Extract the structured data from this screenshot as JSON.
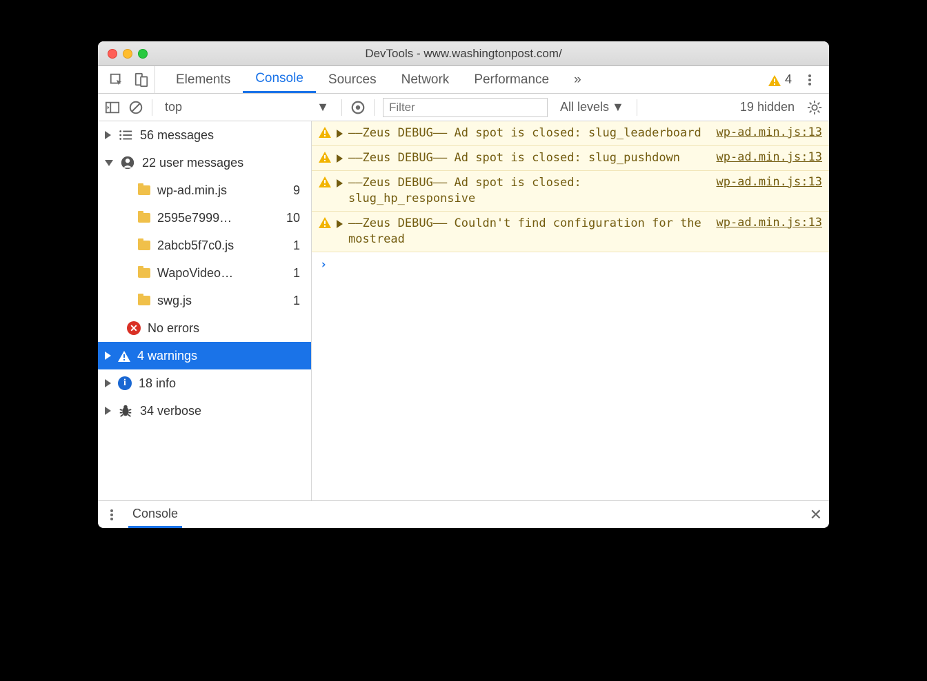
{
  "window": {
    "title": "DevTools - www.washingtonpost.com/"
  },
  "tabs": {
    "items": [
      "Elements",
      "Console",
      "Sources",
      "Network",
      "Performance"
    ],
    "activeIndex": 1,
    "moreSymbol": "»",
    "warningCount": "4"
  },
  "toolbar": {
    "context": "top",
    "filterPlaceholder": "Filter",
    "levelsLabel": "All levels",
    "hiddenLabel": "19 hidden"
  },
  "sidebar": {
    "messages": {
      "label": "56 messages"
    },
    "userMessages": {
      "label": "22 user messages"
    },
    "files": [
      {
        "name": "wp-ad.min.js",
        "count": "9"
      },
      {
        "name": "2595e7999…",
        "count": "10"
      },
      {
        "name": "2abcb5f7c0.js",
        "count": "1"
      },
      {
        "name": "WapoVideo…",
        "count": "1"
      },
      {
        "name": "swg.js",
        "count": "1"
      }
    ],
    "errors": {
      "label": "No errors"
    },
    "warnings": {
      "label": "4 warnings"
    },
    "info": {
      "label": "18 info"
    },
    "verbose": {
      "label": "34 verbose"
    }
  },
  "logs": [
    {
      "text": "––Zeus DEBUG–– Ad spot is closed: slug_leaderboard",
      "source": "wp-ad.min.js:13"
    },
    {
      "text": "––Zeus DEBUG–– Ad spot is closed: slug_pushdown",
      "source": "wp-ad.min.js:13"
    },
    {
      "text": "––Zeus DEBUG–– Ad spot is closed: slug_hp_responsive",
      "source": "wp-ad.min.js:13"
    },
    {
      "text": "––Zeus DEBUG–– Couldn't find configuration for the mostread",
      "source": "wp-ad.min.js:13"
    }
  ],
  "promptSymbol": "›",
  "drawer": {
    "label": "Console"
  }
}
